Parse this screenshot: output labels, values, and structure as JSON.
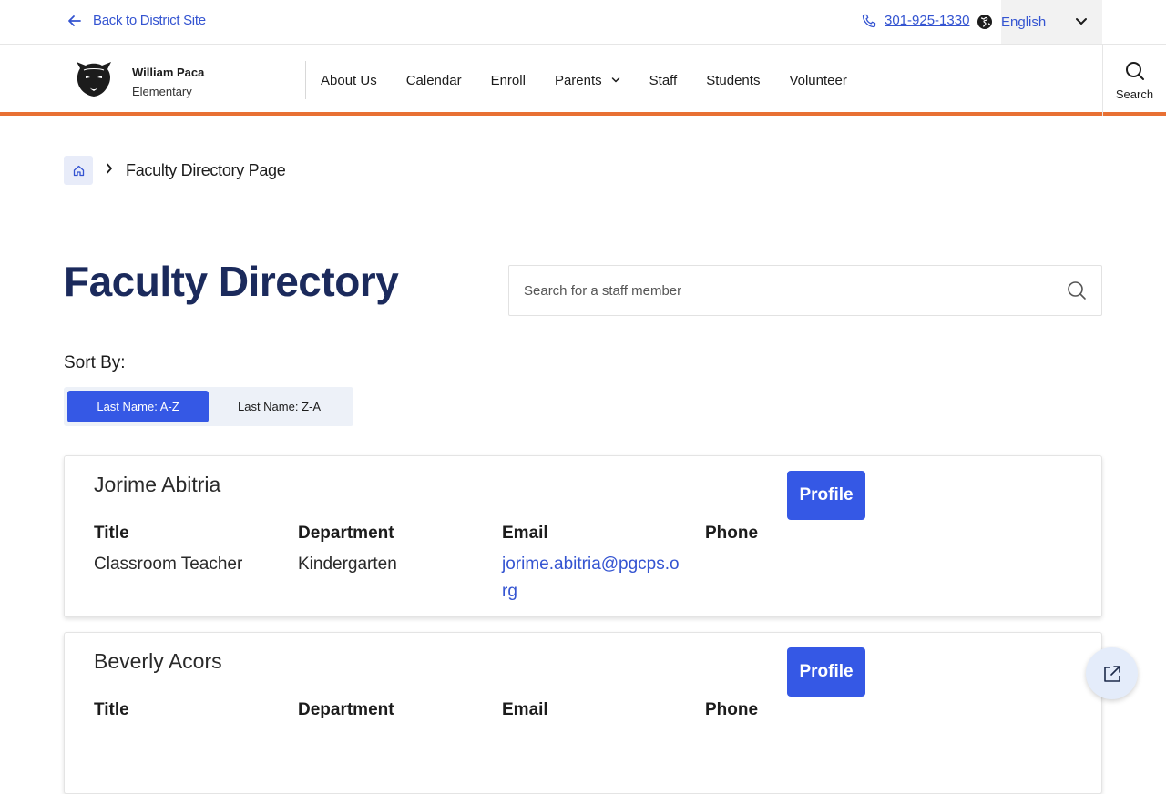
{
  "utility": {
    "back_label": "Back to District Site",
    "phone": "301-925-1330",
    "language": "English"
  },
  "header": {
    "school_line1": "William Paca",
    "school_line2": "Elementary",
    "nav": [
      {
        "label": "About Us"
      },
      {
        "label": "Calendar"
      },
      {
        "label": "Enroll"
      },
      {
        "label": "Parents"
      },
      {
        "label": "Staff"
      },
      {
        "label": "Students"
      },
      {
        "label": "Volunteer"
      }
    ],
    "search_label": "Search"
  },
  "breadcrumb": {
    "current": "Faculty Directory Page"
  },
  "main": {
    "title": "Faculty Directory",
    "search_placeholder": "Search for a staff member",
    "sort_label": "Sort By:",
    "sort_options": [
      {
        "label": "Last Name: A-Z",
        "active": true
      },
      {
        "label": "Last Name: Z-A",
        "active": false
      }
    ],
    "column_headers": {
      "title": "Title",
      "department": "Department",
      "email": "Email",
      "phone": "Phone"
    },
    "profile_label": "Profile",
    "staff": [
      {
        "name": "Jorime Abitria",
        "title": "Classroom Teacher",
        "department": "Kindergarten",
        "email": "jorime.abitria@pgcps.org",
        "phone": ""
      },
      {
        "name": "Beverly Acors",
        "title": "",
        "department": "",
        "email": "",
        "phone": ""
      }
    ]
  },
  "colors": {
    "accent": "#3558e5",
    "link": "#3454d1",
    "title": "#1b2a5c",
    "header_rule": "#e87033"
  }
}
